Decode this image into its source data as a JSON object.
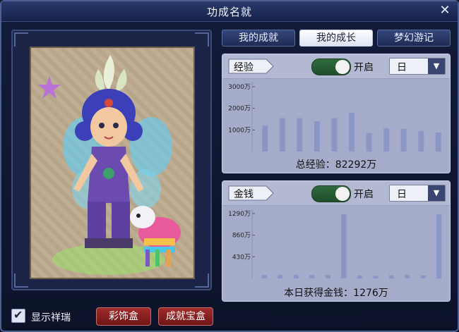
{
  "window": {
    "title": "功成名就"
  },
  "tabs": [
    {
      "label": "我的成就",
      "active": false
    },
    {
      "label": "我的成长",
      "active": true
    },
    {
      "label": "梦幻游记",
      "active": false
    }
  ],
  "experience": {
    "tag": "经验",
    "toggle_label": "开启",
    "toggle_on": true,
    "period": "日",
    "total_text": "总经验：82292万"
  },
  "money": {
    "tag": "金钱",
    "toggle_label": "开启",
    "toggle_on": true,
    "period": "日",
    "total_text": "本日获得金钱：1276万"
  },
  "bottom": {
    "show_label": "显示祥瑞",
    "show_checked": true,
    "decor_box": "彩饰盒",
    "achieve_box": "成就宝盒"
  },
  "colors": {
    "bar": "#8c96c4",
    "panel_bg": "#a5acc9",
    "tab_active": "#ffffff",
    "button_red": "#8c1f1f"
  },
  "chart_data": [
    {
      "type": "bar",
      "title": "",
      "ylim": [
        0,
        3000
      ],
      "y_ticks": [
        1000,
        2000,
        3000
      ],
      "y_tick_labels": [
        "1000万",
        "2000万",
        "3000万"
      ],
      "values": [
        1200,
        1550,
        1550,
        1400,
        1550,
        1800,
        850,
        1080,
        1050,
        950,
        880
      ],
      "grid": false
    },
    {
      "type": "bar",
      "title": "",
      "ylim": [
        0,
        1290
      ],
      "y_ticks": [
        430,
        860,
        1290
      ],
      "y_tick_labels": [
        "430万",
        "860万",
        "1290万"
      ],
      "values": [
        70,
        70,
        70,
        70,
        70,
        1276,
        60,
        50,
        60,
        70,
        60,
        1276
      ],
      "grid": false
    }
  ]
}
